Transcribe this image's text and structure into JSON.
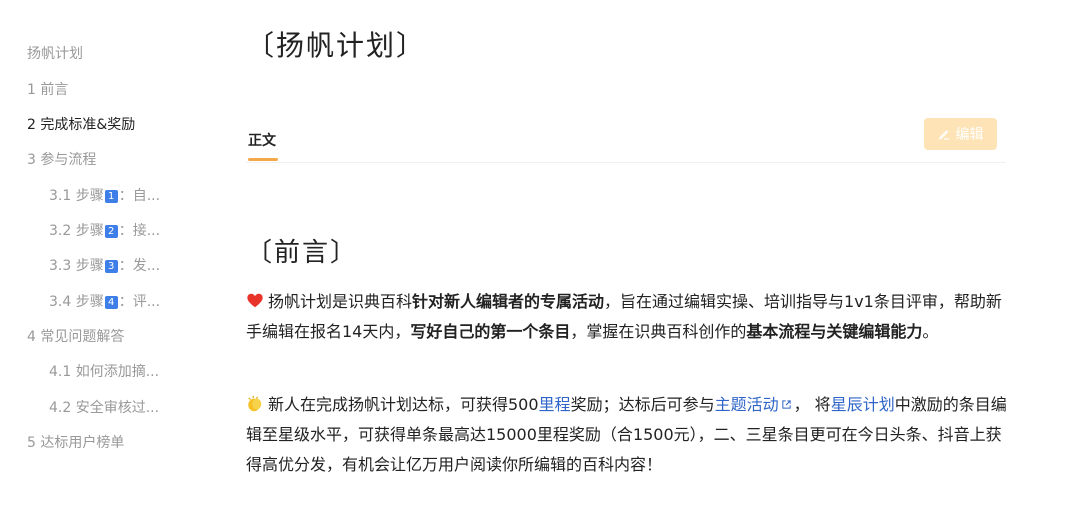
{
  "toc": {
    "title": "扬帆计划",
    "items": [
      {
        "label": "1 前言"
      },
      {
        "label": "2 完成标准&奖励"
      },
      {
        "label": "3 参与流程"
      },
      {
        "prefix": "3.1 步骤",
        "num": "1",
        "suffix": "：自..."
      },
      {
        "prefix": "3.2 步骤",
        "num": "2",
        "suffix": "：接..."
      },
      {
        "prefix": "3.3 步骤",
        "num": "3",
        "suffix": "：发..."
      },
      {
        "prefix": "3.4 步骤",
        "num": "4",
        "suffix": "：评..."
      },
      {
        "label": "4 常见问题解答"
      },
      {
        "label": "4.1 如何添加摘..."
      },
      {
        "label": "4.2 安全审核过..."
      },
      {
        "label": "5 达标用户榜单"
      }
    ]
  },
  "main": {
    "title": "扬帆计划",
    "tab": "正文",
    "edit_label": "编辑",
    "section_title": "前言",
    "p1": {
      "a": "扬帆计划是识典百科",
      "b": "针对新人编辑者的专属活动",
      "c": "，旨在通过编辑实操、培训指导与1v1条目评审，帮助新手编辑在报名14天内，",
      "d": "写好自己的第一个条目",
      "e": "，掌握在识典百科创作的",
      "f": "基本流程与关键编辑能力",
      "g": "。"
    },
    "p2": {
      "a": "新人在完成扬帆计划达标，可获得500",
      "link1": "里程",
      "b": "奖励；达标后可参与",
      "link2": "主题活动",
      "c": "， 将",
      "link3": "星辰计划",
      "d": "中激励的条目编辑至星级水平，可获得单条最高达15000里程奖励（合1500元），二、三星条目更可在今日头条、抖音上获得高优分发，有机会让亿万用户阅读你所编辑的百科内容！"
    }
  },
  "colors": {
    "accent": "#f3a94b",
    "link": "#2f65c8",
    "edit_button": "#fde3b6",
    "keycap": "#3d7ee8"
  }
}
